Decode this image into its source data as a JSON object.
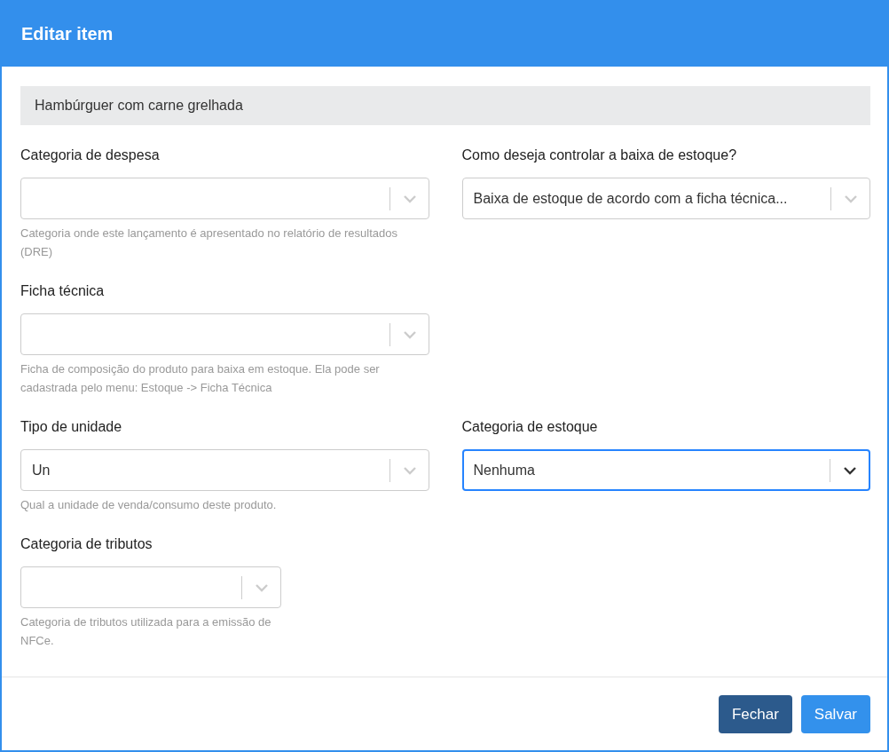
{
  "modal": {
    "title": "Editar item"
  },
  "item_name": "Hambúrguer com carne grelhada",
  "rows": [
    {
      "fields": [
        {
          "kind": "select",
          "label": "Categoria de despesa",
          "help": "Categoria onde este lançamento é apresentado no relatório de resultados (DRE)",
          "focused": false
        },
        {
          "kind": "select",
          "label": "Como deseja controlar a baixa de estoque?",
          "value": "Baixa de estoque de acordo com a ficha técnica...",
          "focused": false
        }
      ]
    },
    {
      "fields": [
        {
          "kind": "select",
          "label": "Ficha técnica",
          "help": "Ficha de composição do produto para baixa em estoque. Ela pode ser cadastrada pelo menu: Estoque -> Ficha Técnica",
          "focused": false
        }
      ]
    },
    {
      "fields": [
        {
          "kind": "select",
          "label": "Tipo de unidade",
          "value": "Un",
          "help": "Qual a unidade de venda/consumo deste produto.",
          "focused": false
        },
        {
          "kind": "select",
          "label": "Categoria de estoque",
          "value": "Nenhuma",
          "focused": true
        }
      ]
    },
    {
      "fields": [
        {
          "kind": "compact",
          "label": "Categoria de tributos",
          "help": "Categoria de tributos utilizada para a emissão de NFCe.",
          "focused": false
        }
      ]
    }
  ],
  "buttons": [
    {
      "label": "Fechar",
      "kind": "secondary"
    },
    {
      "label": "Salvar",
      "kind": "primary"
    }
  ]
}
